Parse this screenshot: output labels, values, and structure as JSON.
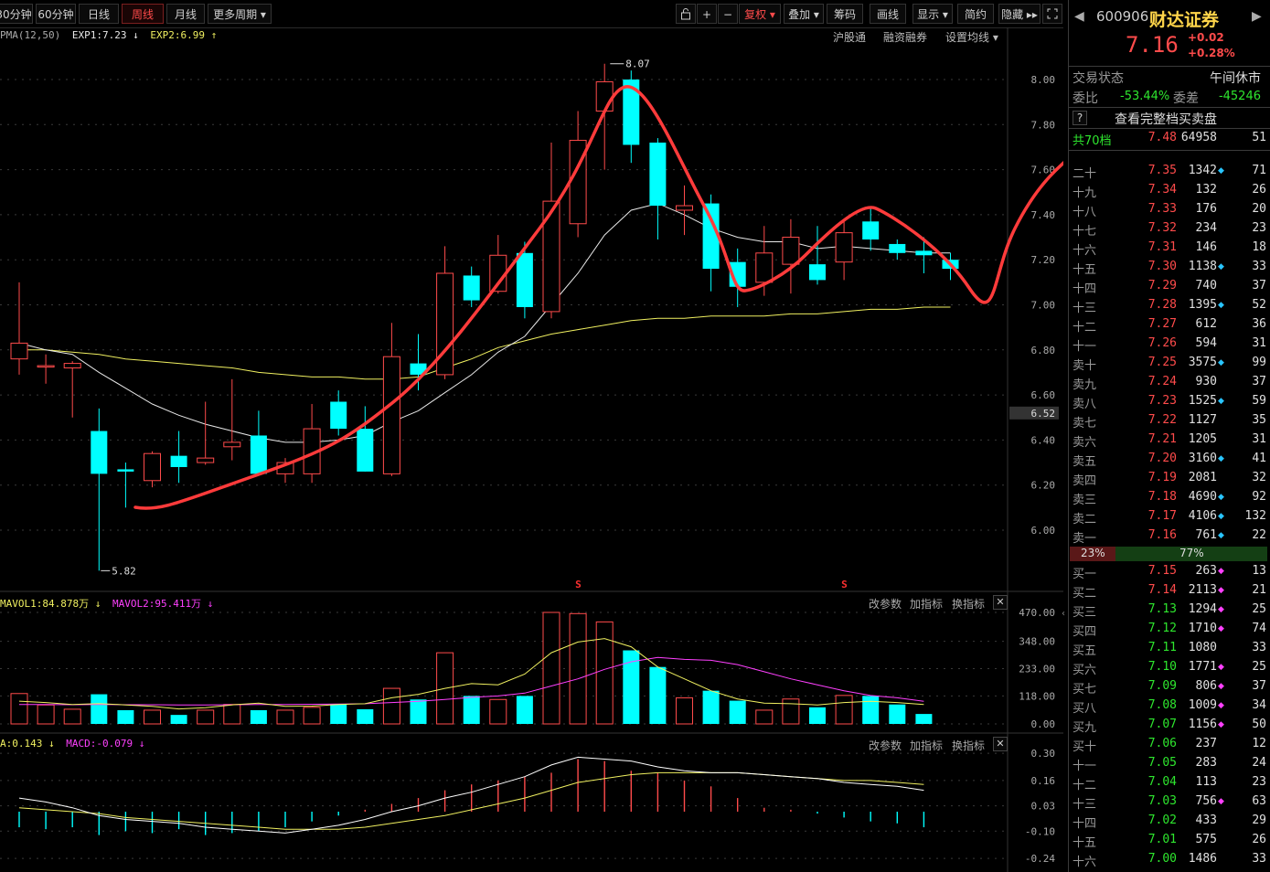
{
  "toolbar": {
    "periods": [
      "30分钟",
      "60分钟",
      "日线",
      "周线",
      "月线",
      "更多周期 ▾"
    ],
    "active_period": "周线",
    "icons": [
      "lock-icon",
      "plus-icon",
      "minus-icon"
    ],
    "fuquan": "复权 ▾",
    "overlay": "叠加 ▾",
    "chips": "筹码",
    "draw": "画线",
    "display": "显示 ▾",
    "simple": "简约",
    "hide": "隐藏 ▸▸"
  },
  "main_legend": {
    "prefix": "PMA(12,50)",
    "exp1": "EXP1:7.23 ↓",
    "exp2": "EXP2:6.99 ↑",
    "links": [
      "沪股通",
      "融资融券",
      "设置均线 ▾"
    ]
  },
  "price_axis": [
    "8.00",
    "7.80",
    "7.60",
    "7.40",
    "7.20",
    "7.00",
    "6.80",
    "6.60",
    "6.40",
    "6.20",
    "6.00"
  ],
  "price_highlight": "6.52",
  "annotations": {
    "high": "8.07",
    "low": "5.82",
    "marker": "S"
  },
  "vol_legend": {
    "mavol1": "MAVOL1:84.878万 ↓",
    "mavol2": "MAVOL2:95.411万 ↓",
    "buttons": [
      "改参数",
      "加指标",
      "换指标"
    ]
  },
  "vol_axis": [
    "470.00",
    "348.00",
    "233.00",
    "118.00",
    "0.00"
  ],
  "macd_legend": {
    "dea": "A:0.143 ↓",
    "macd": "MACD:-0.079 ↓",
    "buttons": [
      "改参数",
      "加指标",
      "换指标"
    ]
  },
  "macd_axis": [
    "0.30",
    "0.16",
    "0.03",
    "-0.10",
    "-0.24"
  ],
  "chart_data": {
    "type": "candlestick",
    "candles": [
      {
        "o": 6.76,
        "h": 7.1,
        "l": 6.69,
        "c": 6.83
      },
      {
        "o": 6.73,
        "h": 6.78,
        "l": 6.65,
        "c": 6.73
      },
      {
        "o": 6.72,
        "h": 6.75,
        "l": 6.5,
        "c": 6.74
      },
      {
        "o": 6.44,
        "h": 6.54,
        "l": 5.82,
        "c": 6.25
      },
      {
        "o": 6.27,
        "h": 6.3,
        "l": 6.1,
        "c": 6.26
      },
      {
        "o": 6.22,
        "h": 6.35,
        "l": 6.19,
        "c": 6.34
      },
      {
        "o": 6.33,
        "h": 6.44,
        "l": 6.21,
        "c": 6.28
      },
      {
        "o": 6.3,
        "h": 6.57,
        "l": 6.29,
        "c": 6.32
      },
      {
        "o": 6.37,
        "h": 6.67,
        "l": 6.31,
        "c": 6.39
      },
      {
        "o": 6.42,
        "h": 6.53,
        "l": 6.25,
        "c": 6.25
      },
      {
        "o": 6.25,
        "h": 6.32,
        "l": 6.21,
        "c": 6.3
      },
      {
        "o": 6.25,
        "h": 6.56,
        "l": 6.21,
        "c": 6.45
      },
      {
        "o": 6.57,
        "h": 6.62,
        "l": 6.42,
        "c": 6.45
      },
      {
        "o": 6.45,
        "h": 6.55,
        "l": 6.26,
        "c": 6.26
      },
      {
        "o": 6.25,
        "h": 6.92,
        "l": 6.24,
        "c": 6.77
      },
      {
        "o": 6.74,
        "h": 6.87,
        "l": 6.62,
        "c": 6.69
      },
      {
        "o": 6.69,
        "h": 7.26,
        "l": 6.67,
        "c": 7.14
      },
      {
        "o": 7.13,
        "h": 7.17,
        "l": 6.99,
        "c": 7.02
      },
      {
        "o": 7.06,
        "h": 7.31,
        "l": 7.05,
        "c": 7.22
      },
      {
        "o": 7.23,
        "h": 7.28,
        "l": 6.94,
        "c": 6.99
      },
      {
        "o": 6.97,
        "h": 7.72,
        "l": 6.94,
        "c": 7.46
      },
      {
        "o": 7.36,
        "h": 7.86,
        "l": 7.3,
        "c": 7.73
      },
      {
        "o": 7.86,
        "h": 8.07,
        "l": 7.6,
        "c": 7.99
      },
      {
        "o": 8.0,
        "h": 8.04,
        "l": 7.63,
        "c": 7.71
      },
      {
        "o": 7.72,
        "h": 7.74,
        "l": 7.29,
        "c": 7.44
      },
      {
        "o": 7.42,
        "h": 7.53,
        "l": 7.31,
        "c": 7.44
      },
      {
        "o": 7.45,
        "h": 7.49,
        "l": 7.06,
        "c": 7.16
      },
      {
        "o": 7.19,
        "h": 7.25,
        "l": 6.99,
        "c": 7.08
      },
      {
        "o": 7.1,
        "h": 7.35,
        "l": 7.04,
        "c": 7.23
      },
      {
        "o": 7.18,
        "h": 7.38,
        "l": 7.05,
        "c": 7.3
      },
      {
        "o": 7.18,
        "h": 7.35,
        "l": 7.09,
        "c": 7.11
      },
      {
        "o": 7.19,
        "h": 7.38,
        "l": 7.11,
        "c": 7.32
      },
      {
        "o": 7.37,
        "h": 7.43,
        "l": 7.24,
        "c": 7.29
      },
      {
        "o": 7.27,
        "h": 7.29,
        "l": 7.2,
        "c": 7.23
      },
      {
        "o": 7.24,
        "h": 7.3,
        "l": 7.14,
        "c": 7.22
      },
      {
        "o": 7.2,
        "h": 7.23,
        "l": 7.11,
        "c": 7.16
      }
    ],
    "exp1": [
      6.83,
      6.8,
      6.78,
      6.7,
      6.63,
      6.56,
      6.51,
      6.47,
      6.44,
      6.41,
      6.39,
      6.39,
      6.4,
      6.42,
      6.48,
      6.53,
      6.61,
      6.69,
      6.79,
      6.86,
      7.0,
      7.14,
      7.31,
      7.42,
      7.45,
      7.4,
      7.34,
      7.3,
      7.28,
      7.28,
      7.25,
      7.26,
      7.25,
      7.24,
      7.23,
      7.23
    ],
    "exp2": [
      6.8,
      6.8,
      6.79,
      6.78,
      6.76,
      6.75,
      6.74,
      6.73,
      6.72,
      6.7,
      6.69,
      6.68,
      6.68,
      6.67,
      6.67,
      6.68,
      6.72,
      6.76,
      6.81,
      6.84,
      6.87,
      6.89,
      6.91,
      6.93,
      6.94,
      6.94,
      6.95,
      6.95,
      6.95,
      6.96,
      6.96,
      6.97,
      6.98,
      6.98,
      6.99,
      6.99
    ],
    "volume": [
      128,
      80,
      62,
      125,
      58,
      58,
      38,
      58,
      82,
      58,
      58,
      70,
      82,
      62,
      150,
      103,
      300,
      118,
      103,
      118,
      470,
      465,
      430,
      310,
      240,
      110,
      140,
      98,
      58,
      105,
      70,
      120,
      118,
      82,
      42
    ],
    "mavol1": [
      96,
      90,
      82,
      86,
      80,
      74,
      63,
      68,
      80,
      88,
      74,
      75,
      82,
      85,
      110,
      125,
      150,
      170,
      165,
      210,
      300,
      345,
      360,
      325,
      240,
      190,
      140,
      105,
      88,
      85,
      80,
      90,
      95,
      90,
      82
    ],
    "mavol2": [
      82,
      82,
      81,
      82,
      81,
      81,
      80,
      80,
      81,
      82,
      82,
      83,
      84,
      85,
      90,
      95,
      103,
      112,
      118,
      130,
      160,
      190,
      230,
      262,
      280,
      272,
      268,
      250,
      220,
      190,
      165,
      140,
      120,
      110,
      95
    ],
    "macd_hist": [
      -0.08,
      -0.09,
      -0.08,
      -0.12,
      -0.1,
      -0.11,
      -0.09,
      -0.12,
      -0.11,
      -0.1,
      -0.08,
      -0.05,
      -0.02,
      0.01,
      0.04,
      0.07,
      0.11,
      0.14,
      0.16,
      0.18,
      0.2,
      0.27,
      0.26,
      0.21,
      0.2,
      0.16,
      0.13,
      0.07,
      0.02,
      0.01,
      -0.01,
      -0.03,
      -0.05,
      -0.06,
      -0.08
    ],
    "dif": [
      0.07,
      0.05,
      0.02,
      -0.02,
      -0.04,
      -0.05,
      -0.06,
      -0.08,
      -0.09,
      -0.1,
      -0.11,
      -0.09,
      -0.07,
      -0.04,
      0.0,
      0.03,
      0.07,
      0.1,
      0.14,
      0.18,
      0.24,
      0.28,
      0.27,
      0.26,
      0.23,
      0.21,
      0.2,
      0.2,
      0.19,
      0.18,
      0.17,
      0.15,
      0.14,
      0.13,
      0.11
    ],
    "dea": [
      0.02,
      0.01,
      0.0,
      -0.01,
      -0.03,
      -0.04,
      -0.05,
      -0.06,
      -0.07,
      -0.08,
      -0.09,
      -0.09,
      -0.09,
      -0.08,
      -0.06,
      -0.04,
      -0.02,
      0.01,
      0.04,
      0.07,
      0.11,
      0.15,
      0.17,
      0.19,
      0.2,
      0.2,
      0.2,
      0.2,
      0.19,
      0.18,
      0.17,
      0.16,
      0.16,
      0.15,
      0.14
    ]
  },
  "quote": {
    "code": "600906",
    "name": "财达证券",
    "price": "7.16",
    "change": "+0.02",
    "change_pct": "+0.28%",
    "status_label": "交易状态",
    "status_value": "午间休市",
    "weibi_label": "委比",
    "weibi_value": "-53.44%",
    "weicha_label": "委差",
    "weicha_value": "-45246",
    "help": "?",
    "full_book": "查看完整档买卖盘",
    "levels_label": "共70档",
    "levels_price": "7.48",
    "levels_vol": "64958",
    "levels_cnt": "51",
    "ratio_left": "23%",
    "ratio_right": "77%"
  },
  "asks": [
    {
      "label": "二十",
      "price": "7.35",
      "vol": "1342",
      "cnt": "71",
      "dot": "blue"
    },
    {
      "label": "十九",
      "price": "7.34",
      "vol": "132",
      "cnt": "26",
      "dot": ""
    },
    {
      "label": "十八",
      "price": "7.33",
      "vol": "176",
      "cnt": "20",
      "dot": ""
    },
    {
      "label": "十七",
      "price": "7.32",
      "vol": "234",
      "cnt": "23",
      "dot": ""
    },
    {
      "label": "十六",
      "price": "7.31",
      "vol": "146",
      "cnt": "18",
      "dot": ""
    },
    {
      "label": "十五",
      "price": "7.30",
      "vol": "1138",
      "cnt": "33",
      "dot": "blue"
    },
    {
      "label": "十四",
      "price": "7.29",
      "vol": "740",
      "cnt": "37",
      "dot": ""
    },
    {
      "label": "十三",
      "price": "7.28",
      "vol": "1395",
      "cnt": "52",
      "dot": "blue"
    },
    {
      "label": "十二",
      "price": "7.27",
      "vol": "612",
      "cnt": "36",
      "dot": ""
    },
    {
      "label": "十一",
      "price": "7.26",
      "vol": "594",
      "cnt": "31",
      "dot": ""
    },
    {
      "label": "卖十",
      "price": "7.25",
      "vol": "3575",
      "cnt": "99",
      "dot": "blue"
    },
    {
      "label": "卖九",
      "price": "7.24",
      "vol": "930",
      "cnt": "37",
      "dot": ""
    },
    {
      "label": "卖八",
      "price": "7.23",
      "vol": "1525",
      "cnt": "59",
      "dot": "blue"
    },
    {
      "label": "卖七",
      "price": "7.22",
      "vol": "1127",
      "cnt": "35",
      "dot": ""
    },
    {
      "label": "卖六",
      "price": "7.21",
      "vol": "1205",
      "cnt": "31",
      "dot": ""
    },
    {
      "label": "卖五",
      "price": "7.20",
      "vol": "3160",
      "cnt": "41",
      "dot": "blue"
    },
    {
      "label": "卖四",
      "price": "7.19",
      "vol": "2081",
      "cnt": "32",
      "dot": ""
    },
    {
      "label": "卖三",
      "price": "7.18",
      "vol": "4690",
      "cnt": "92",
      "dot": "blue"
    },
    {
      "label": "卖二",
      "price": "7.17",
      "vol": "4106",
      "cnt": "132",
      "dot": "blue"
    },
    {
      "label": "卖一",
      "price": "7.16",
      "vol": "761",
      "cnt": "22",
      "dot": "blue"
    }
  ],
  "bids": [
    {
      "label": "买一",
      "price": "7.15",
      "vol": "263",
      "cnt": "13",
      "dot": "pink"
    },
    {
      "label": "买二",
      "price": "7.14",
      "vol": "2113",
      "cnt": "21",
      "dot": "pink"
    },
    {
      "label": "买三",
      "price": "7.13",
      "vol": "1294",
      "cnt": "25",
      "dot": "pink"
    },
    {
      "label": "买四",
      "price": "7.12",
      "vol": "1710",
      "cnt": "74",
      "dot": "pink"
    },
    {
      "label": "买五",
      "price": "7.11",
      "vol": "1080",
      "cnt": "33",
      "dot": ""
    },
    {
      "label": "买六",
      "price": "7.10",
      "vol": "1771",
      "cnt": "25",
      "dot": "pink"
    },
    {
      "label": "买七",
      "price": "7.09",
      "vol": "806",
      "cnt": "37",
      "dot": "pink"
    },
    {
      "label": "买八",
      "price": "7.08",
      "vol": "1009",
      "cnt": "34",
      "dot": "pink"
    },
    {
      "label": "买九",
      "price": "7.07",
      "vol": "1156",
      "cnt": "50",
      "dot": "pink"
    },
    {
      "label": "买十",
      "price": "7.06",
      "vol": "237",
      "cnt": "12",
      "dot": ""
    },
    {
      "label": "十一",
      "price": "7.05",
      "vol": "283",
      "cnt": "24",
      "dot": ""
    },
    {
      "label": "十二",
      "price": "7.04",
      "vol": "113",
      "cnt": "23",
      "dot": ""
    },
    {
      "label": "十三",
      "price": "7.03",
      "vol": "756",
      "cnt": "63",
      "dot": "pink"
    },
    {
      "label": "十四",
      "price": "7.02",
      "vol": "433",
      "cnt": "29",
      "dot": ""
    },
    {
      "label": "十五",
      "price": "7.01",
      "vol": "575",
      "cnt": "26",
      "dot": ""
    },
    {
      "label": "十六",
      "price": "7.00",
      "vol": "1486",
      "cnt": "33",
      "dot": ""
    }
  ],
  "colors": {
    "up": "#ff4b4b",
    "down": "#00ffff",
    "exp1": "#e8e8e8",
    "exp2": "#f0f060",
    "mavol1": "#f0f060",
    "mavol2": "#ff40ff",
    "dif": "#ffffff",
    "dea": "#f0f060",
    "annotation": "#ff5555"
  }
}
